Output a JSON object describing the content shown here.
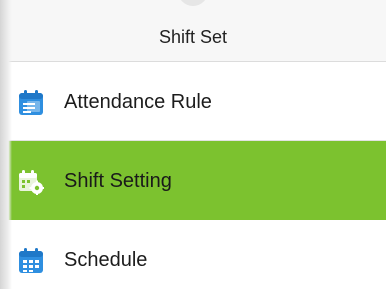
{
  "header": {
    "title": "Shift Set"
  },
  "menu": {
    "items": [
      {
        "label": "Attendance Rule",
        "icon": "attendance-rule-icon",
        "selected": false
      },
      {
        "label": "Shift Setting",
        "icon": "shift-setting-icon",
        "selected": true
      },
      {
        "label": "Schedule",
        "icon": "schedule-calendar-icon",
        "selected": false
      }
    ]
  },
  "colors": {
    "selected_background": "#7cc22f",
    "icon_blue": "#2f8fe0",
    "header_background": "#f7f7f7"
  }
}
